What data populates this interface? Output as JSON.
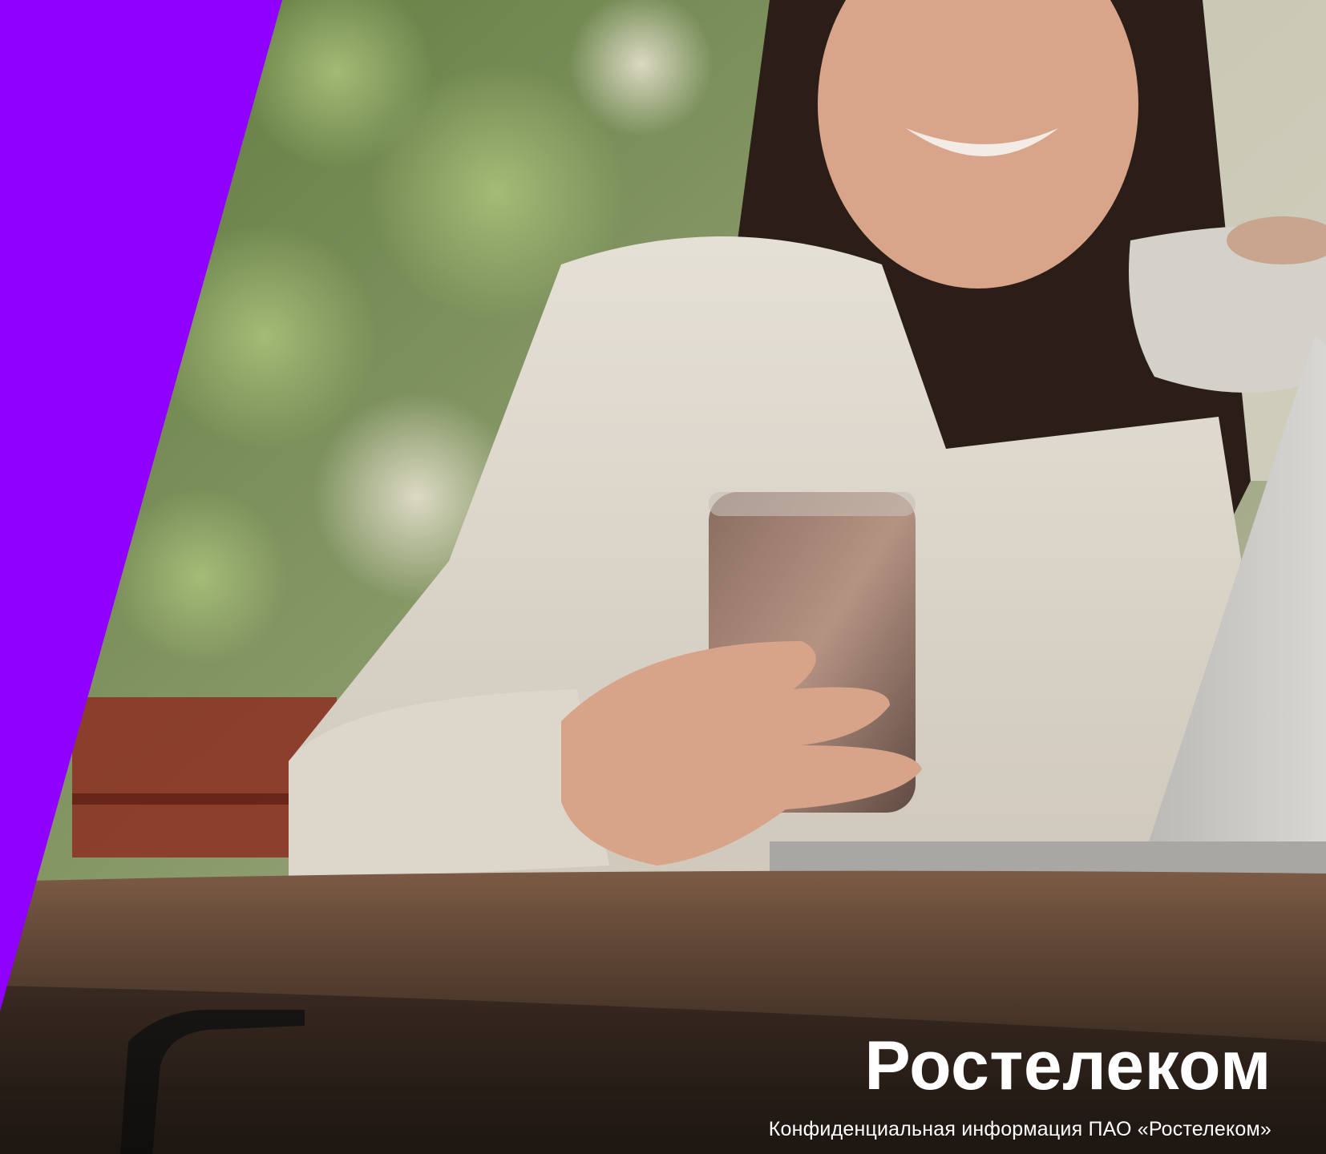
{
  "brand": {
    "logo_text": "Ростелеком",
    "caption": "Конфиденциальная информация ПАО «Ростелеком»"
  },
  "colors": {
    "accent_purple": "#8F00FF",
    "text": "#FFFFFF"
  },
  "photo": {
    "subject": "woman-holding-smartphone-at-cafe-table"
  }
}
